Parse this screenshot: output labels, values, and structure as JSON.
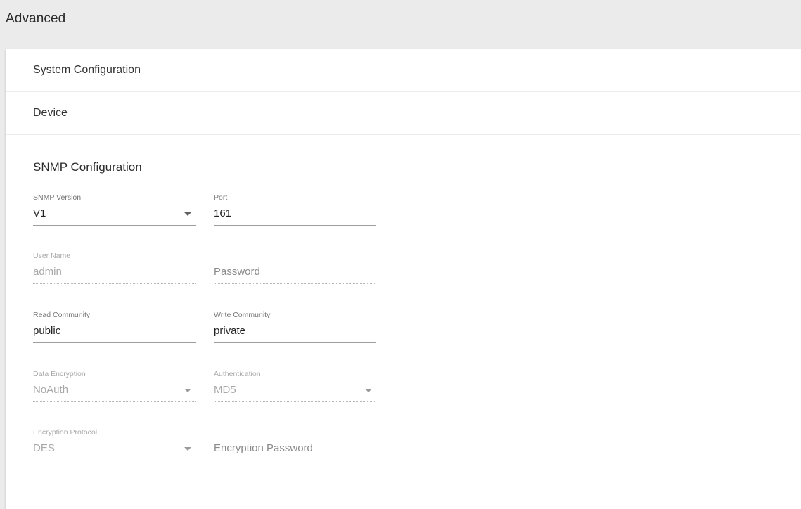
{
  "header": {
    "title": "Advanced"
  },
  "sections": {
    "system_configuration": "System Configuration",
    "device": "Device"
  },
  "snmp": {
    "title": "SNMP Configuration",
    "version": {
      "label": "SNMP Version",
      "value": "V1"
    },
    "port": {
      "label": "Port",
      "value": "161"
    },
    "user_name": {
      "label": "User Name",
      "value": "admin"
    },
    "password": {
      "placeholder": "Password"
    },
    "read_community": {
      "label": "Read Community",
      "value": "public"
    },
    "write_community": {
      "label": "Write Community",
      "value": "private"
    },
    "data_encryption": {
      "label": "Data Encryption",
      "value": "NoAuth"
    },
    "authentication": {
      "label": "Authentication",
      "value": "MD5"
    },
    "encryption_protocol": {
      "label": "Encryption Protocol",
      "value": "DES"
    },
    "encryption_password": {
      "placeholder": "Encryption Password"
    }
  },
  "icons": {
    "dropdown": "caret-down-icon"
  },
  "colors": {
    "background": "#ebebeb",
    "card": "#ffffff",
    "underline": "#9e9e9e",
    "disabled_text": "#a8a8a8"
  }
}
